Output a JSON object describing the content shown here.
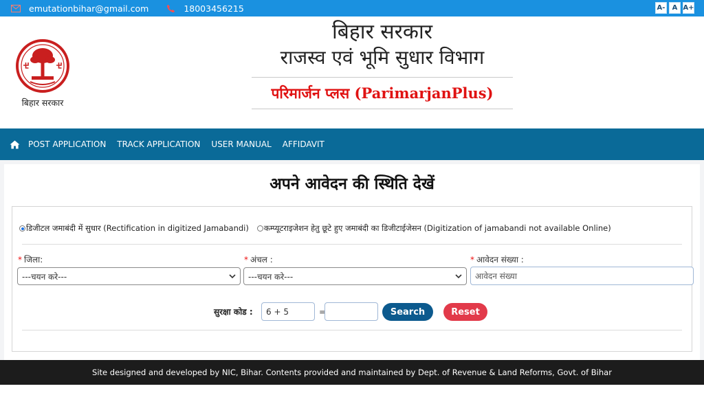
{
  "topbar": {
    "email": "emutationbihar@gmail.com",
    "phone": "18003456215",
    "font_decrease": "A-",
    "font_normal": "A",
    "font_increase": "A+"
  },
  "header": {
    "emblem_label": "बिहार सरकार",
    "title_line1": "बिहार सरकार",
    "title_line2": "राजस्व एवं भूमि सुधार विभाग",
    "subtitle": "परिमार्जन प्लस (ParimarjanPlus)"
  },
  "nav": {
    "items": [
      "POST APPLICATION",
      "TRACK APPLICATION",
      "USER MANUAL",
      "AFFIDAVIT"
    ]
  },
  "main": {
    "page_title": "अपने आवेदन की स्थिति देखें",
    "radio_options": [
      {
        "label": "डिजीटल जमाबंदी में सुधार (Rectification in digitized Jamabandi)",
        "selected": true
      },
      {
        "label": "कम्प्यूटराइजेशन हेतु छूटे हुए जमाबंदी का डिजीटाईजेसन (Digitization of jamabandi not available Online)",
        "selected": false
      }
    ],
    "district": {
      "label": "जिला:",
      "value": "---चयन करे---"
    },
    "circle": {
      "label": "अंचल :",
      "value": "---चयन करे---"
    },
    "application_no": {
      "label": "आवेदन संख्या :",
      "placeholder": "आवेदन संख्या"
    },
    "captcha": {
      "label": "सुरक्षा कोड :",
      "question": "6 + 5",
      "equals": "="
    },
    "search_label": "Search",
    "reset_label": "Reset"
  },
  "footer": {
    "text": "Site designed and developed by NIC, Bihar. Contents provided and maintained by Dept. of Revenue & Land Reforms, Govt. of Bihar"
  },
  "colors": {
    "topbar": "#1a91e0",
    "nav": "#0a6a98",
    "subtitle": "#e01212",
    "search_button": "#0c5a8e",
    "reset_button": "#e23a4a",
    "footer": "#1c1c1c"
  }
}
